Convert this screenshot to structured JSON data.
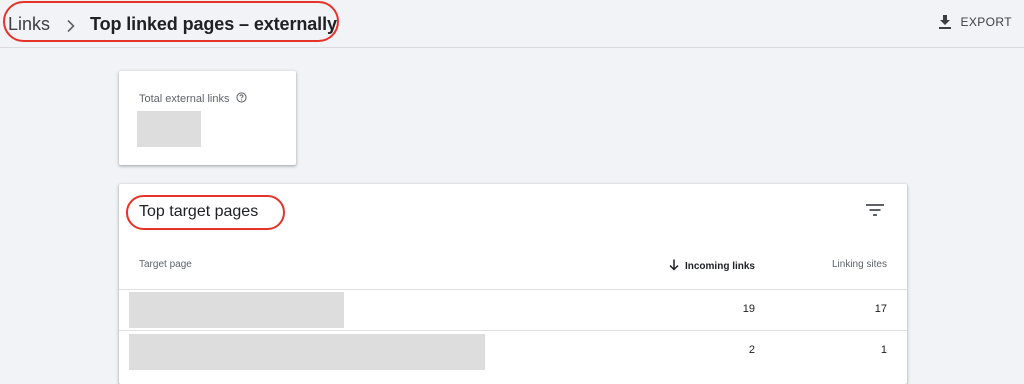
{
  "header": {
    "breadcrumb_root": "Links",
    "breadcrumb_current": "Top linked pages – externally",
    "export_label": "EXPORT"
  },
  "summary": {
    "title": "Total external links",
    "help_icon": "help-circle-icon",
    "value": ""
  },
  "table": {
    "title": "Top target pages",
    "filter_icon": "filter-list-icon",
    "columns": {
      "target": "Target page",
      "incoming": "Incoming links",
      "linking": "Linking sites"
    },
    "sort_icon": "arrow-down-icon",
    "rows": [
      {
        "target": "",
        "incoming": "19",
        "linking": "17"
      },
      {
        "target": "",
        "incoming": "2",
        "linking": "1"
      }
    ]
  },
  "colors": {
    "annotation": "#e6332a",
    "background": "#f1f3f6"
  }
}
